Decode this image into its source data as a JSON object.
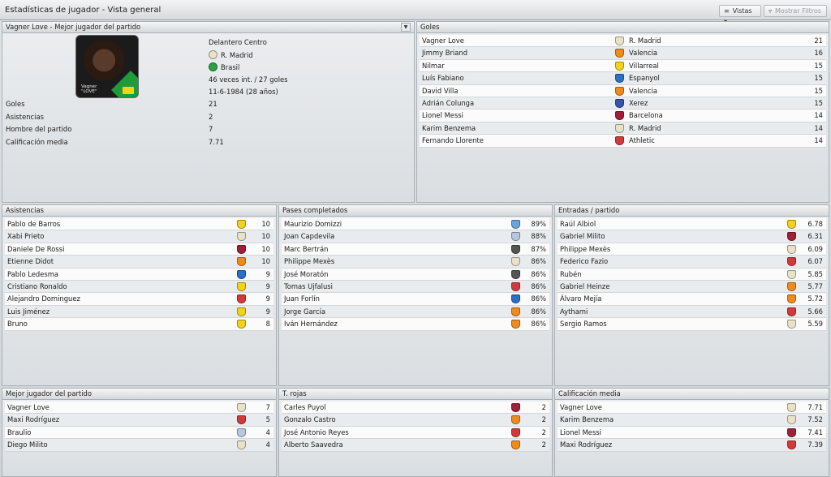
{
  "window": {
    "title": "Estadísticas de jugador - Vista general",
    "views_label": "Vistas",
    "filters_label": "Mostrar Filtros"
  },
  "profile": {
    "header": "Vagner Love - Mejor jugador del partido",
    "photo_caption_1": "Vagner",
    "photo_caption_2": "\"LOVE\"",
    "position": "Delantero Centro",
    "club": "R. Madrid",
    "club_color": "#e9e2c8",
    "nation": "Brasil",
    "nation_color": "#2ea043",
    "caps": "46 veces int. / 27 goles",
    "dob": "11-6-1984 (28 años)",
    "stats": [
      {
        "label": "Goles",
        "value": "21"
      },
      {
        "label": "Asistencias",
        "value": "2"
      },
      {
        "label": "Hombre del partido",
        "value": "7"
      },
      {
        "label": "Calificación media",
        "value": "7.71"
      }
    ]
  },
  "goles": {
    "title": "Goles",
    "rows": [
      {
        "name": "Vagner Love",
        "club": "R. Madrid",
        "value": "21",
        "color": "#e9e2c8"
      },
      {
        "name": "Jimmy Briand",
        "club": "Valencia",
        "value": "16",
        "color": "#f08a1c"
      },
      {
        "name": "Nilmar",
        "club": "Villarreal",
        "value": "15",
        "color": "#f3d21b"
      },
      {
        "name": "Luís Fabiano",
        "club": "Espanyol",
        "value": "15",
        "color": "#2a6fc9"
      },
      {
        "name": "David Villa",
        "club": "Valencia",
        "value": "15",
        "color": "#f08a1c"
      },
      {
        "name": "Adrián Colunga",
        "club": "Xerez",
        "value": "15",
        "color": "#3355aa"
      },
      {
        "name": "Lionel Messi",
        "club": "Barcelona",
        "value": "14",
        "color": "#a0203a"
      },
      {
        "name": "Karim Benzema",
        "club": "R. Madrid",
        "value": "14",
        "color": "#e9e2c8"
      },
      {
        "name": "Fernando Llorente",
        "club": "Athletic",
        "value": "14",
        "color": "#d23a3a"
      }
    ]
  },
  "asistencias": {
    "title": "Asistencias",
    "rows": [
      {
        "name": "Pablo de Barros",
        "value": "10",
        "color": "#f3d21b"
      },
      {
        "name": "Xabi Prieto",
        "value": "10",
        "color": "#e9e2c8"
      },
      {
        "name": "Daniele De Rossi",
        "value": "10",
        "color": "#a0203a"
      },
      {
        "name": "Etienne Didot",
        "value": "10",
        "color": "#f08a1c"
      },
      {
        "name": "Pablo Ledesma",
        "value": "9",
        "color": "#2a6fc9"
      },
      {
        "name": "Cristiano Ronaldo",
        "value": "9",
        "color": "#f3d21b"
      },
      {
        "name": "Alejandro Dominguez",
        "value": "9",
        "color": "#d23a3a"
      },
      {
        "name": "Luis Jiménez",
        "value": "9",
        "color": "#f3d21b"
      },
      {
        "name": "Bruno",
        "value": "8",
        "color": "#f3d21b"
      }
    ]
  },
  "pases": {
    "title": "Pases completados",
    "rows": [
      {
        "name": "Maurizio Domizzi",
        "value": "89%",
        "color": "#6aa4e0"
      },
      {
        "name": "Joan Capdevila",
        "value": "88%",
        "color": "#b7c7dd"
      },
      {
        "name": "Marc Bertrán",
        "value": "87%",
        "color": "#555555"
      },
      {
        "name": "Philippe Mexès",
        "value": "86%",
        "color": "#e9e2c8"
      },
      {
        "name": "José Moratón",
        "value": "86%",
        "color": "#555555"
      },
      {
        "name": "Tomas Ujfalusi",
        "value": "86%",
        "color": "#d23a3a"
      },
      {
        "name": "Juan Forlín",
        "value": "86%",
        "color": "#2a6fc9"
      },
      {
        "name": "Jorge García",
        "value": "86%",
        "color": "#f08a1c"
      },
      {
        "name": "Iván Hernández",
        "value": "86%",
        "color": "#f08a1c"
      }
    ]
  },
  "entradas": {
    "title": "Entradas / partido",
    "rows": [
      {
        "name": "Raúl Albiol",
        "value": "6.78",
        "color": "#f3d21b"
      },
      {
        "name": "Gabriel Milito",
        "value": "6.31",
        "color": "#a0203a"
      },
      {
        "name": "Philippe Mexès",
        "value": "6.09",
        "color": "#e9e2c8"
      },
      {
        "name": "Federico Fazio",
        "value": "6.07",
        "color": "#d23a3a"
      },
      {
        "name": "Rubén",
        "value": "5.85",
        "color": "#e9e2c8"
      },
      {
        "name": "Gabriel Heinze",
        "value": "5.77",
        "color": "#f08a1c"
      },
      {
        "name": "Álvaro Mejía",
        "value": "5.72",
        "color": "#f08a1c"
      },
      {
        "name": "Aythami",
        "value": "5.66",
        "color": "#d23a3a"
      },
      {
        "name": "Sergio Ramos",
        "value": "5.59",
        "color": "#e9e2c8"
      }
    ]
  },
  "mejor": {
    "title": "Mejor jugador del partido",
    "rows": [
      {
        "name": "Vagner Love",
        "value": "7",
        "color": "#e9e2c8"
      },
      {
        "name": "Maxi Rodríguez",
        "value": "5",
        "color": "#d23a3a"
      },
      {
        "name": "Braulio",
        "value": "4",
        "color": "#b7c7dd"
      },
      {
        "name": "Diego Milito",
        "value": "4",
        "color": "#e9e2c8"
      }
    ]
  },
  "rojas": {
    "title": "T. rojas",
    "rows": [
      {
        "name": "Carles Puyol",
        "value": "2",
        "color": "#a0203a"
      },
      {
        "name": "Gonzalo Castro",
        "value": "2",
        "color": "#f08a1c"
      },
      {
        "name": "José Antonio Reyes",
        "value": "2",
        "color": "#d23a3a"
      },
      {
        "name": "Alberto Saavedra",
        "value": "2",
        "color": "#f08a1c"
      }
    ]
  },
  "calificacion": {
    "title": "Calificación media",
    "rows": [
      {
        "name": "Vagner Love",
        "value": "7.71",
        "color": "#e9e2c8"
      },
      {
        "name": "Karim Benzema",
        "value": "7.52",
        "color": "#e9e2c8"
      },
      {
        "name": "Lionel Messi",
        "value": "7.41",
        "color": "#a0203a"
      },
      {
        "name": "Maxi Rodríguez",
        "value": "7.39",
        "color": "#d23a3a"
      }
    ]
  }
}
